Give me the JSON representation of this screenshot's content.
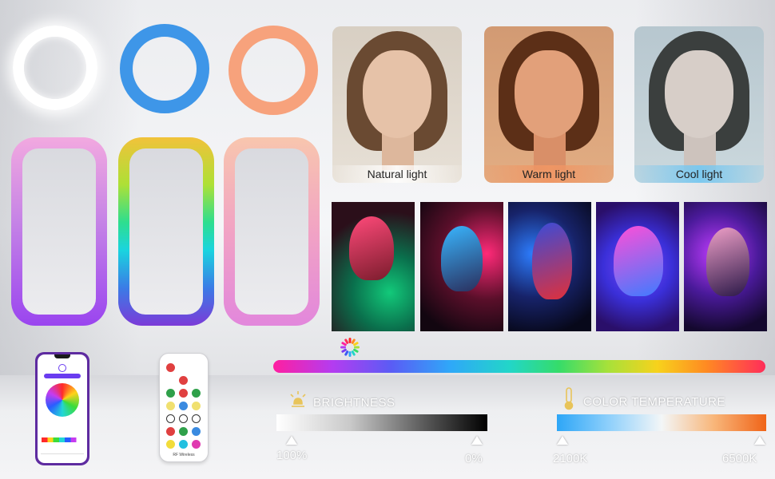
{
  "portraits": [
    {
      "caption": "Natural light"
    },
    {
      "caption": "Warm light"
    },
    {
      "caption": "Cool light"
    }
  ],
  "brightness": {
    "label": "BRIGHTNESS",
    "min_label": "100%",
    "max_label": "0%"
  },
  "color_temperature": {
    "label": "COLOR TEMPERATURE",
    "min_label": "2100K",
    "max_label": "6500K"
  },
  "remote": {
    "brand": "RF Wireless"
  },
  "icons": [
    "color-wheel-icon",
    "bulb-icon",
    "thermometer-icon",
    "power-icon"
  ],
  "colors": {
    "ring_white": "#ffffff",
    "ring_blue": "#3e96e8",
    "ring_peach": "#f7a27c",
    "label_text": "#ffffff"
  }
}
